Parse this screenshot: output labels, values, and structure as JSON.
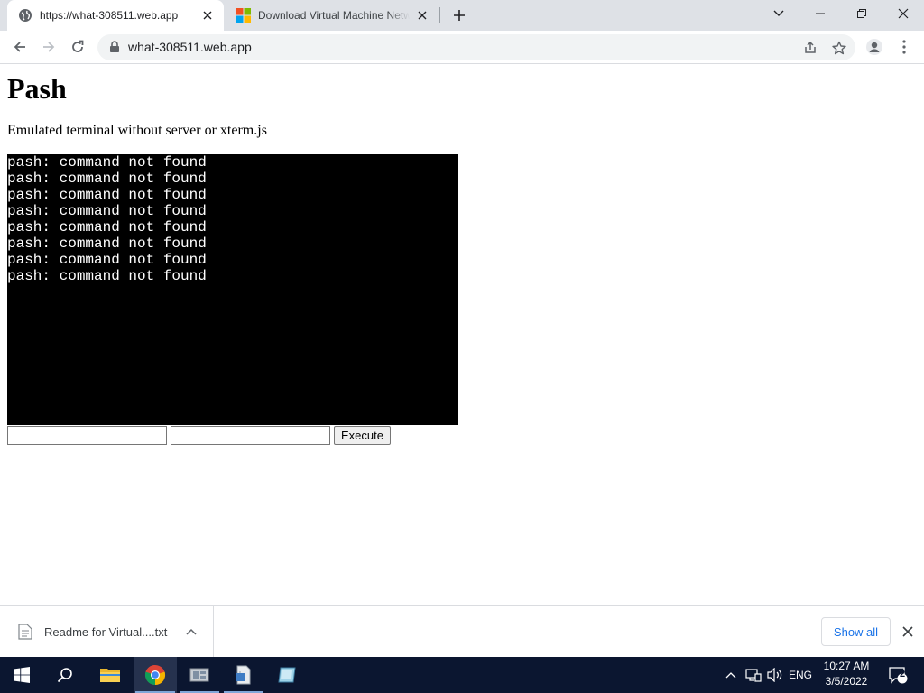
{
  "browser": {
    "tabs": [
      {
        "title": "https://what-308511.web.app",
        "icon": "globe-icon",
        "active": true
      },
      {
        "title": "Download Virtual Machine Netwo",
        "icon": "microsoft-logo-icon",
        "active": false
      }
    ],
    "address": {
      "url": "what-308511.web.app"
    }
  },
  "page": {
    "heading": "Pash",
    "description": "Emulated terminal without server or xterm.js",
    "terminal_lines": [
      "pash: command not found",
      "pash: command not found",
      "pash: command not found",
      "pash: command not found",
      "pash: command not found",
      "pash: command not found",
      "pash: command not found",
      "pash: command not found"
    ],
    "input1": {
      "value": ""
    },
    "input2": {
      "value": ""
    },
    "execute_label": "Execute"
  },
  "downloads": {
    "file_name": "Readme for Virtual....txt",
    "show_all_label": "Show all"
  },
  "taskbar": {
    "language": "ENG",
    "time": "10:27 AM",
    "date": "3/5/2022",
    "notification_count": "2"
  },
  "colors": {
    "tabstrip": "#dee1e6",
    "terminal_bg": "#000000",
    "terminal_fg": "#ffffff",
    "link_blue": "#1a73e8",
    "taskbar": "#0b1630"
  }
}
